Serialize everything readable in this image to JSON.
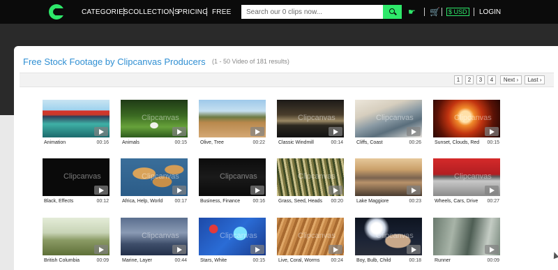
{
  "nav": {
    "categories": "CATEGORIES",
    "collections": "COLLECTIONS",
    "pricing": "PRICING",
    "free": "FREE",
    "search_placeholder": "Search our 0 clips now...",
    "currency": "$ USD",
    "login": "LOGIN"
  },
  "page": {
    "title": "Free Stock Footage by Clipcanvas Producers",
    "count": "(1 - 50  Video of 181 results)"
  },
  "pagination": {
    "pages": [
      "1",
      "2",
      "3",
      "4"
    ],
    "next": "Next ›",
    "last": "Last ›"
  },
  "watermark": "Clipcanvas",
  "clips": [
    {
      "label": "Animation",
      "duration": "00:16"
    },
    {
      "label": "Animals",
      "duration": "00:15"
    },
    {
      "label": "Olive, Tree",
      "duration": "00:22"
    },
    {
      "label": "Classic Windmill",
      "duration": "00:14"
    },
    {
      "label": "Cliffs, Coast",
      "duration": "00:26"
    },
    {
      "label": "Sunset, Clouds, Red",
      "duration": "00:15"
    },
    {
      "label": "Black, Effects",
      "duration": "00:12"
    },
    {
      "label": "Africa, Help, World",
      "duration": "00:17"
    },
    {
      "label": "Business, Finance",
      "duration": "00:16"
    },
    {
      "label": "Grass, Seed, Heads",
      "duration": "00:20"
    },
    {
      "label": "Lake Maggiore",
      "duration": "00:23"
    },
    {
      "label": "Wheels, Cars, Drive",
      "duration": "00:27"
    },
    {
      "label": "British Columbia",
      "duration": "00:09"
    },
    {
      "label": "Marine, Layer",
      "duration": "00:44"
    },
    {
      "label": "Stars, White",
      "duration": "00:15"
    },
    {
      "label": "Live, Coral, Worms",
      "duration": "00:24"
    },
    {
      "label": "Boy, Bulb, Child",
      "duration": "00:18"
    },
    {
      "label": "Runner",
      "duration": "00:09"
    }
  ],
  "colors": {
    "accent_green": "#2ee86a",
    "title_blue": "#2f8fd3",
    "topbar": "#0b0b0b"
  },
  "icons": {
    "logo": "clipcanvas-logo",
    "search": "search-icon",
    "hand": "hand-icon",
    "cart": "cart-icon",
    "play": "play-icon"
  }
}
